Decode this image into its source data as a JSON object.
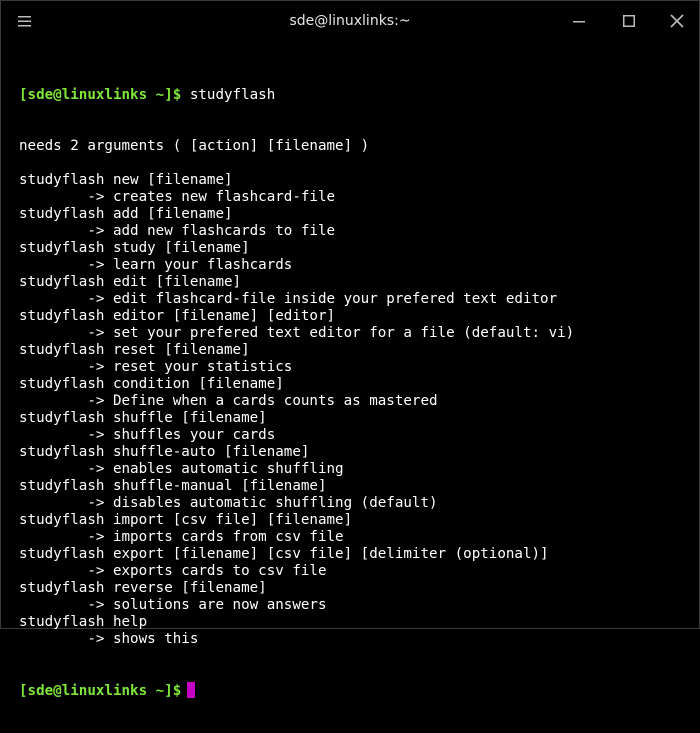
{
  "window": {
    "title": "sde@linuxlinks:~",
    "icons": [
      "menu-icon",
      "minimize-icon",
      "maximize-icon",
      "close-icon"
    ]
  },
  "colors": {
    "background": "#000000",
    "text": "#ffffff",
    "prompt": "#7ee63a",
    "cursor": "#c400c4"
  },
  "terminal": {
    "prompt": "[sde@linuxlinks ~]$",
    "command": "studyflash",
    "output": [
      "needs 2 arguments ( [action] [filename] )",
      "",
      "studyflash new [filename]",
      "        -> creates new flashcard-file",
      "studyflash add [filename]",
      "        -> add new flashcards to file",
      "studyflash study [filename]",
      "        -> learn your flashcards",
      "studyflash edit [filename]",
      "        -> edit flashcard-file inside your prefered text editor",
      "studyflash editor [filename] [editor]",
      "        -> set your prefered text editor for a file (default: vi)",
      "studyflash reset [filename]",
      "        -> reset your statistics",
      "studyflash condition [filename]",
      "        -> Define when a cards counts as mastered",
      "studyflash shuffle [filename]",
      "        -> shuffles your cards",
      "studyflash shuffle-auto [filename]",
      "        -> enables automatic shuffling",
      "studyflash shuffle-manual [filename]",
      "        -> disables automatic shuffling (default)",
      "studyflash import [csv file] [filename]",
      "        -> imports cards from csv file",
      "studyflash export [filename] [csv file] [delimiter (optional)]",
      "        -> exports cards to csv file",
      "studyflash reverse [filename]",
      "        -> solutions are now answers",
      "studyflash help",
      "        -> shows this"
    ],
    "final_prompt": "[sde@linuxlinks ~]$"
  }
}
